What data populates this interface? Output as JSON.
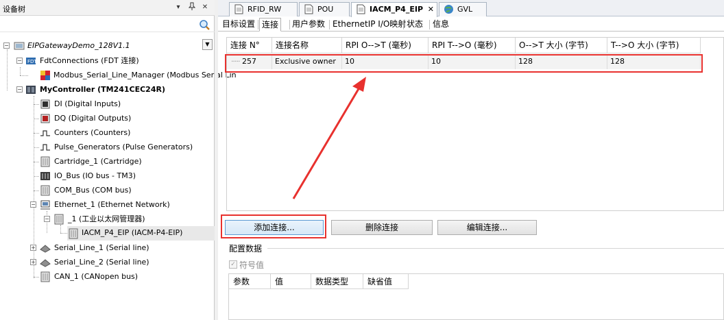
{
  "left_panel": {
    "title": "设备树",
    "controls": [
      "▾",
      "ᵠ",
      "✕"
    ],
    "search_placeholder": "",
    "root_device": "EIPGatewayDemo_128V1.1",
    "tree": [
      {
        "label": "FdtConnections (FDT 连接)",
        "icon": "fdt-icon"
      },
      {
        "label": "Modbus_Serial_Line_Manager (Modbus Serial Lin",
        "icon": "modbus-icon"
      },
      {
        "label": "MyController (TM241CEC24R)",
        "icon": "controller-icon"
      },
      {
        "label": "DI (Digital Inputs)",
        "icon": "di-icon"
      },
      {
        "label": "DQ (Digital Outputs)",
        "icon": "dq-icon"
      },
      {
        "label": "Counters (Counters)",
        "icon": "counter-icon"
      },
      {
        "label": "Pulse_Generators (Pulse Generators)",
        "icon": "pulse-icon"
      },
      {
        "label": "Cartridge_1 (Cartridge)",
        "icon": "cartridge-icon"
      },
      {
        "label": "IO_Bus (IO bus - TM3)",
        "icon": "iobus-icon"
      },
      {
        "label": "COM_Bus (COM bus)",
        "icon": "combus-icon"
      },
      {
        "label": "Ethernet_1 (Ethernet Network)",
        "icon": "ethernet-icon"
      },
      {
        "label": "_1 (工业以太网管理器)",
        "icon": "module-icon"
      },
      {
        "label": "IACM_P4_EIP (IACM-P4-EIP)",
        "icon": "device-icon"
      },
      {
        "label": "Serial_Line_1 (Serial line)",
        "icon": "serial-icon"
      },
      {
        "label": "Serial_Line_2 (Serial line)",
        "icon": "serial-icon"
      },
      {
        "label": "CAN_1 (CANopen bus)",
        "icon": "can-icon"
      }
    ]
  },
  "editor_tabs": [
    {
      "label": "RFID_RW",
      "icon": "doc-icon"
    },
    {
      "label": "POU",
      "icon": "doc-icon"
    },
    {
      "label": "IACM_P4_EIP",
      "icon": "doc-icon",
      "active": true,
      "close": "✕"
    },
    {
      "label": "GVL",
      "icon": "globe-icon"
    }
  ],
  "sub_tabs": [
    "目标设置",
    "连接",
    "用户参数",
    "EthernetIP I/O映射",
    "状态",
    "信息"
  ],
  "connections_table": {
    "headers": [
      "连接 N°",
      "连接名称",
      "RPI O-->T (毫秒)",
      "RPI T-->O (毫秒)",
      "O-->T 大小 (字节)",
      "T-->O 大小 (字节)"
    ],
    "rows": [
      [
        "257",
        "Exclusive owner",
        "10",
        "10",
        "128",
        "128"
      ]
    ]
  },
  "buttons": {
    "add": "添加连接...",
    "delete": "删除连接",
    "edit": "编辑连接..."
  },
  "config": {
    "title": "配置数据",
    "checkbox_label": "符号值",
    "checkbox_checked": true,
    "headers": [
      "参数",
      "值",
      "数据类型",
      "缺省值"
    ]
  },
  "annotation_color": "#e8312e"
}
